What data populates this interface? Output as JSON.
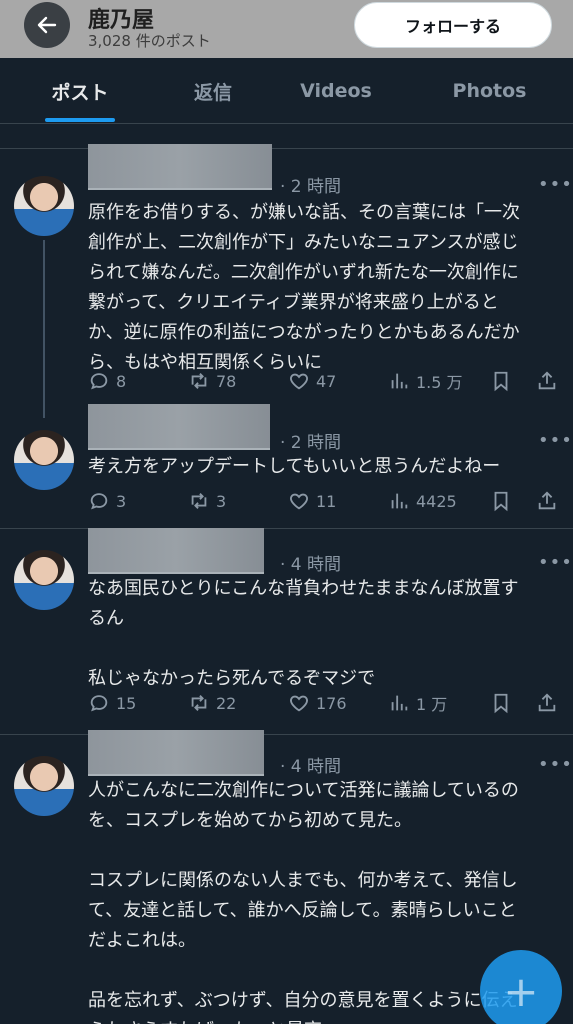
{
  "header": {
    "title": "鹿乃屋",
    "subtitle": "3,028 件のポスト",
    "follow_label": "フォローする"
  },
  "tabs": [
    {
      "label": "ポスト"
    },
    {
      "label": "返信"
    },
    {
      "label": "Videos"
    },
    {
      "label": "Photos"
    }
  ],
  "posts": [
    {
      "time": "· 2 時間",
      "text": "原作をお借りする、が嫌いな話、その言葉には「一次\n創作が上、二次創作が下」みたいなニュアンスが感じ\nられて嫌なんだ。二次創作がいずれ新たな一次創作に\n繋がって、クリエイティブ業界が将来盛り上がると\nか、逆に原作の利益につながったりとかもあるんだか\nら、もはや相互関係くらいに",
      "replies": "8",
      "reposts": "78",
      "likes": "47",
      "views": "1.5 万"
    },
    {
      "time": "· 2 時間",
      "text": "考え方をアップデートしてもいいと思うんだよねー",
      "replies": "3",
      "reposts": "3",
      "likes": "11",
      "views": "4425"
    },
    {
      "time": "· 4 時間",
      "text": "なあ国民ひとりにこんな背負わせたままなんぼ放置す\nるん\n\n私じゃなかったら死んでるぞマジで",
      "replies": "15",
      "reposts": "22",
      "likes": "176",
      "views": "1 万"
    },
    {
      "time": "· 4 時間",
      "text": "人がこんなに二次創作について活発に議論しているの\nを、コスプレを始めてから初めて見た。\n\nコスプレに関係のない人までも、何か考えて、発信し\nて、友達と話して、誰かへ反論して。素晴らしいこと\nだよこれは。\n\n品を忘れず、ぶつけず、自分の意見を置くように伝え\nられさえすれば、もっと最高。"
    }
  ],
  "more_glyph": "•••",
  "fab_glyph": "+"
}
